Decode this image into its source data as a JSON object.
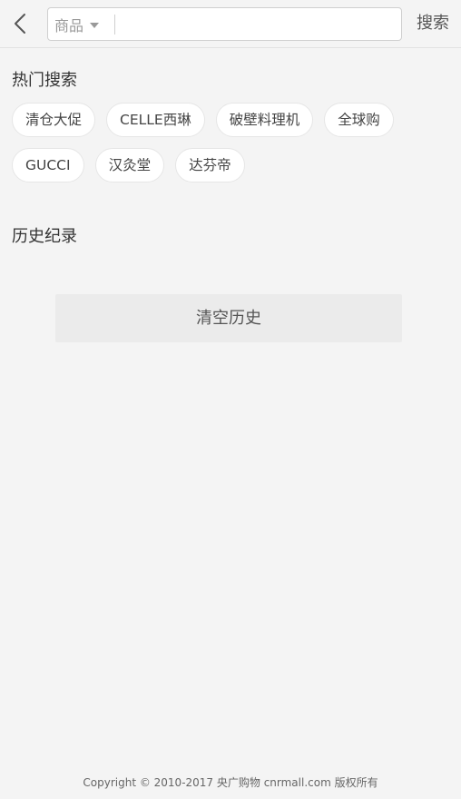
{
  "header": {
    "category_label": "商品",
    "search_placeholder": "",
    "search_value": "",
    "search_button_label": "搜索"
  },
  "hot_search": {
    "title": "热门搜索",
    "rows": [
      [
        "清仓大促",
        "CELLE西琳",
        "破壁料理机",
        "全球购"
      ],
      [
        "GUCCI",
        "汉灸堂",
        "达芬帝"
      ]
    ]
  },
  "history": {
    "title": "历史纪录",
    "clear_label": "清空历史"
  },
  "footer": {
    "copyright": "Copyright © 2010-2017 央广购物 cnrmall.com 版权所有"
  }
}
